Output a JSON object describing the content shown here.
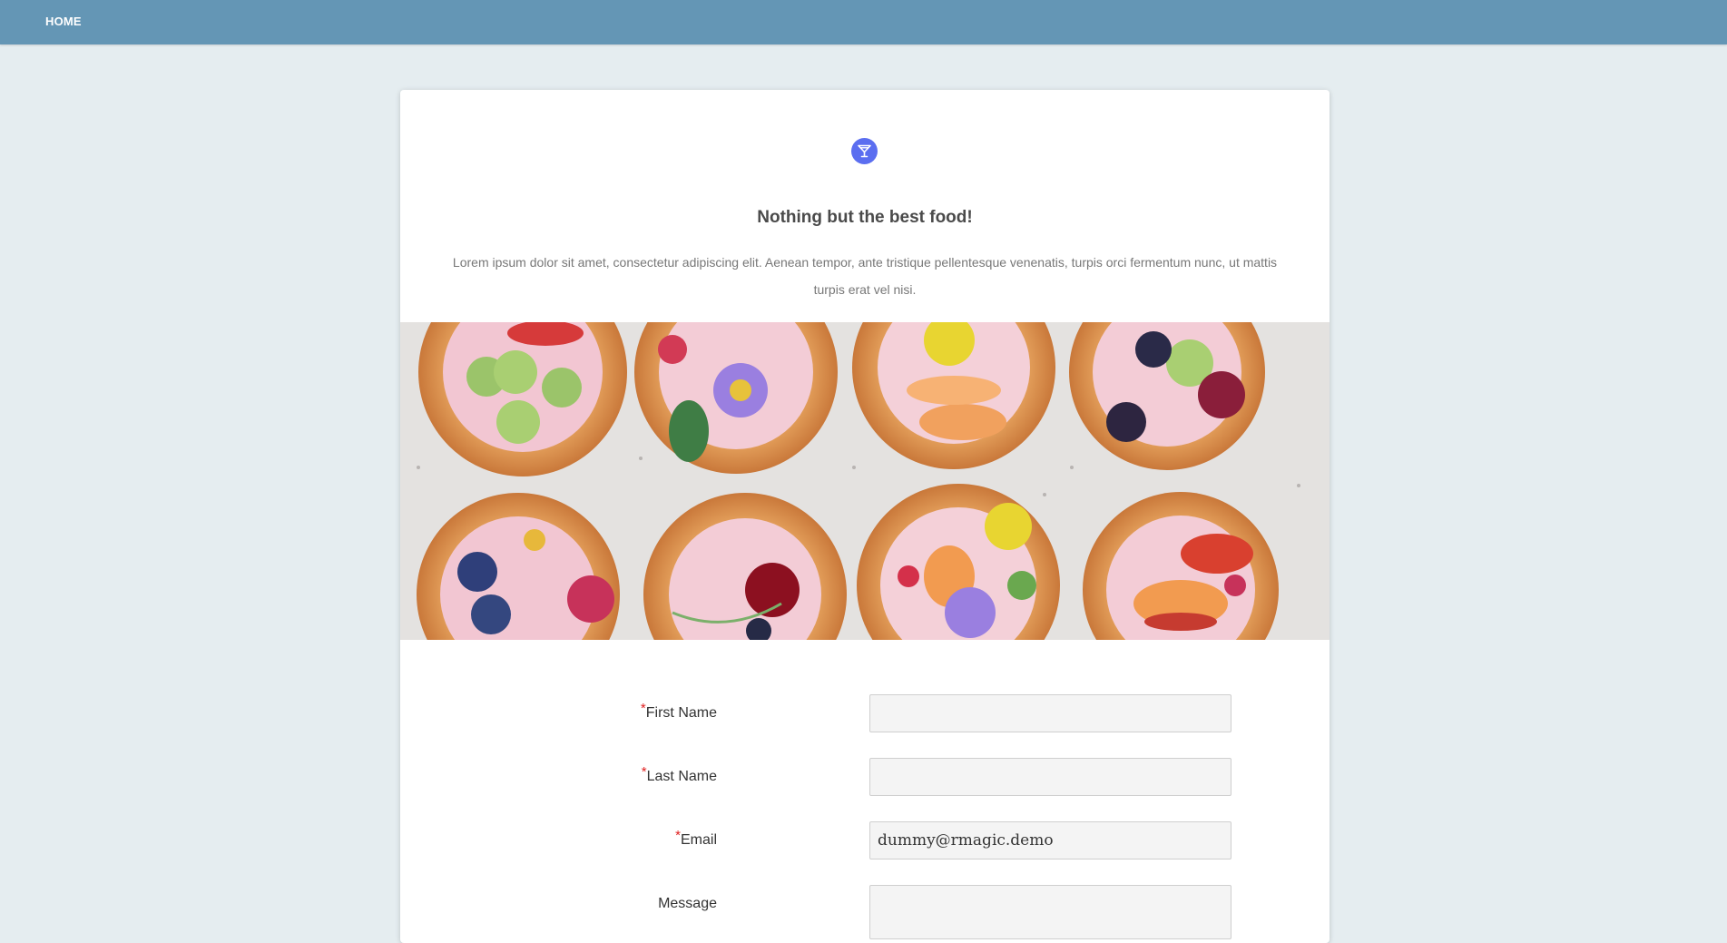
{
  "nav": {
    "home_label": "HOME"
  },
  "colors": {
    "topbar": "#6496b5",
    "page_bg": "#e5edf0",
    "accent": "#5b6ef0",
    "required": "#e02020"
  },
  "header": {
    "icon": "cocktail-glass-icon",
    "title": "Nothing but the best food!",
    "description": "Lorem ipsum dolor sit amet, consectetur adipiscing elit. Aenean tempor, ante tristique pellentesque venenatis, turpis orci fermentum nunc, ut mattis turpis erat vel nisi."
  },
  "banner": {
    "image": "donuts-with-fruit-and-flowers-photo"
  },
  "form": {
    "required_mark": "*",
    "fields": [
      {
        "label": "First Name",
        "required": true,
        "value": ""
      },
      {
        "label": "Last Name",
        "required": true,
        "value": ""
      },
      {
        "label": "Email",
        "required": true,
        "value": "dummy@rmagic.demo"
      },
      {
        "label": "Message",
        "required": false,
        "value": ""
      }
    ]
  }
}
